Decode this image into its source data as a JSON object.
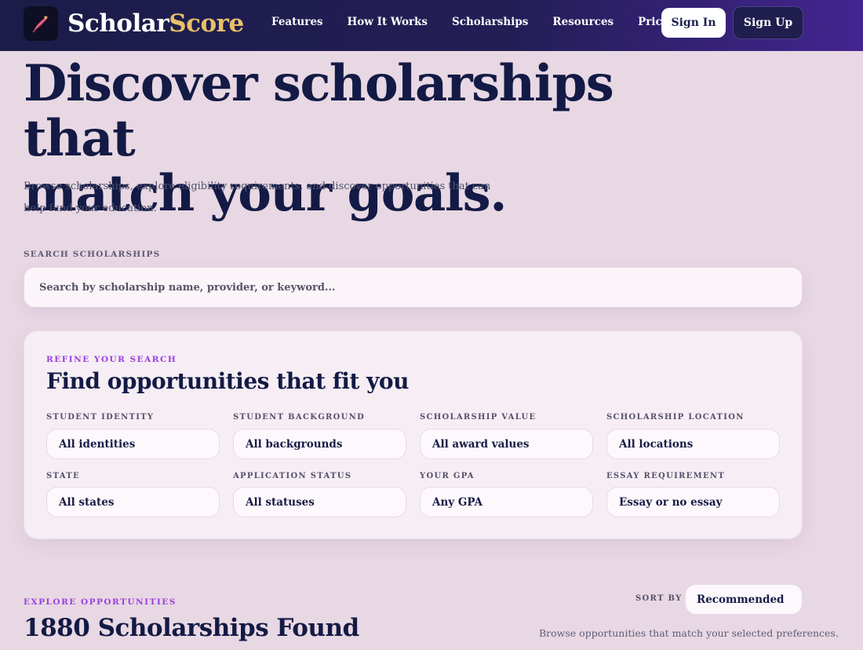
{
  "nav": {
    "brand_part1": "Scholar",
    "brand_part2": "Score",
    "links": [
      "Features",
      "How It Works",
      "Scholarships",
      "Resources",
      "Pricing"
    ],
    "sign_in": "Sign In",
    "sign_up": "Sign Up"
  },
  "hero": {
    "title_line1": "Discover scholarships that",
    "title_line2": "match your goals.",
    "subtitle": "Browse scholarships, explore eligibility requirements, and discover opportunities that can help fund your education."
  },
  "search": {
    "label": "SEARCH SCHOLARSHIPS",
    "placeholder": "Search by scholarship name, provider, or keyword...",
    "value": ""
  },
  "filters": {
    "eyebrow": "REFINE YOUR SEARCH",
    "title": "Find opportunities that fit you",
    "items": [
      {
        "label": "STUDENT IDENTITY",
        "value": "All identities"
      },
      {
        "label": "STUDENT BACKGROUND",
        "value": "All backgrounds"
      },
      {
        "label": "SCHOLARSHIP VALUE",
        "value": "All award values"
      },
      {
        "label": "SCHOLARSHIP LOCATION",
        "value": "All locations"
      },
      {
        "label": "STATE",
        "value": "All states"
      },
      {
        "label": "APPLICATION STATUS",
        "value": "All statuses"
      },
      {
        "label": "YOUR GPA",
        "value": "Any GPA"
      },
      {
        "label": "ESSAY REQUIREMENT",
        "value": "Essay or no essay"
      }
    ]
  },
  "results": {
    "eyebrow": "EXPLORE OPPORTUNITIES",
    "count_title": "1880 Scholarships Found",
    "sort_label": "SORT BY",
    "sort_value": "Recommended",
    "subtitle": "Browse opportunities that match your selected preferences."
  },
  "colors": {
    "accent": "#9b3fe0",
    "brand_gold": "#e8c06a",
    "navy": "#131a45",
    "background": "#e8d8e3"
  },
  "icons": {
    "logo": "quill-logo-icon"
  }
}
